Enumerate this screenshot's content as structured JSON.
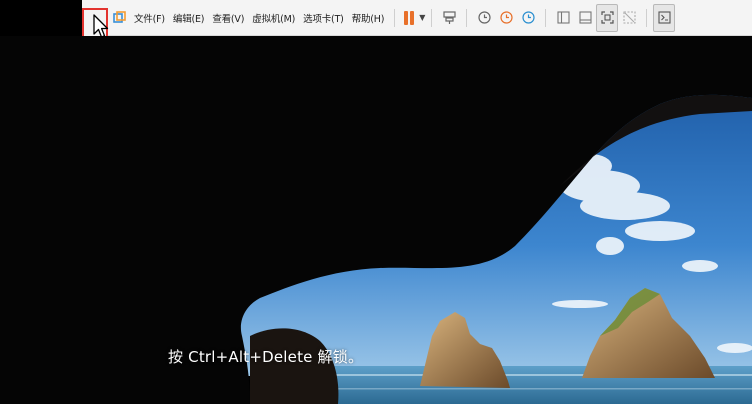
{
  "toolbar": {
    "menus": [
      {
        "id": "file",
        "label": "文件(F)"
      },
      {
        "id": "edit",
        "label": "编辑(E)"
      },
      {
        "id": "view",
        "label": "查看(V)"
      },
      {
        "id": "vm",
        "label": "虚拟机(M)"
      },
      {
        "id": "tabs",
        "label": "选项卡(T)"
      },
      {
        "id": "help",
        "label": "帮助(H)"
      }
    ],
    "icons": {
      "collapse": "chevron-left-icon",
      "app": "vmware-icon",
      "pause": "pause-icon",
      "send_keys": "send-ctrl-alt-del-icon",
      "snapshot": "snapshot-icon",
      "revert": "revert-snapshot-icon",
      "snapshot_manager": "snapshot-manager-icon",
      "library": "library-icon",
      "thumbnail": "thumbnail-bar-icon",
      "fullscreen": "fullscreen-icon",
      "unity": "unity-icon",
      "console": "console-view-icon"
    },
    "accent_color": "#e8702a",
    "highlight_color": "#e3342f"
  },
  "lockscreen": {
    "unlock_prompt": "按 Ctrl+Alt+Delete 解锁。"
  }
}
